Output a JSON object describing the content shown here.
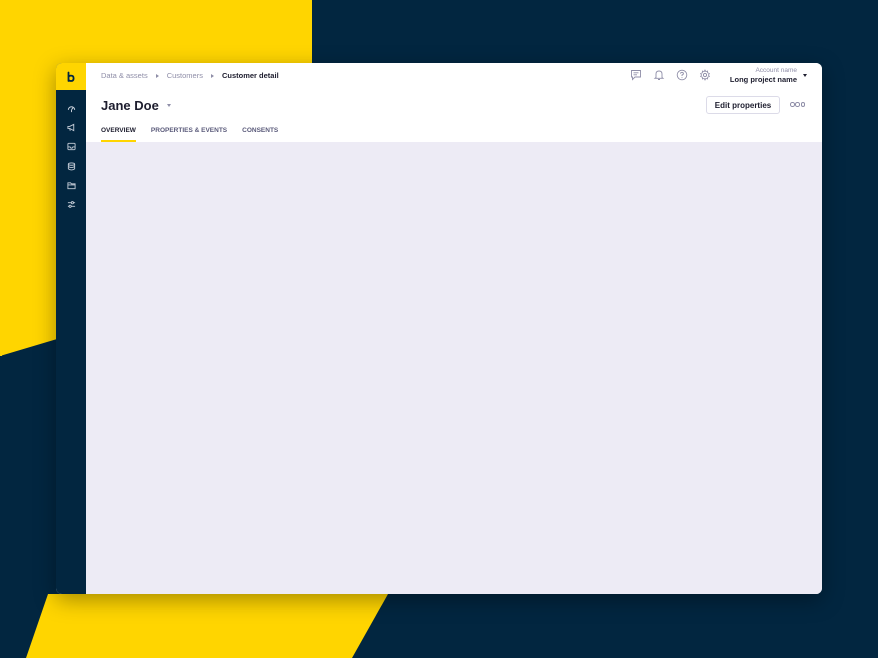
{
  "colors": {
    "brand_yellow": "#FFD500",
    "navy": "#022640",
    "content_bg": "#edebf5",
    "text_primary": "#1d1d2e",
    "text_muted": "#8f8ea8"
  },
  "sidebar": {
    "logo_icon": "bloomreach-logo-icon",
    "items": [
      {
        "icon": "dashboard-gauge-icon"
      },
      {
        "icon": "campaign-megaphone-icon"
      },
      {
        "icon": "inbox-icon"
      },
      {
        "icon": "database-icon"
      },
      {
        "icon": "folder-icon"
      },
      {
        "icon": "settings-sliders-icon"
      }
    ]
  },
  "breadcrumb": {
    "items": [
      "Data & assets",
      "Customers"
    ],
    "current": "Customer detail"
  },
  "topbar": {
    "icons": [
      "chat-icon",
      "bell-icon",
      "help-icon",
      "gear-icon"
    ],
    "account_name": "Account name",
    "project_name": "Long project name"
  },
  "header": {
    "title": "Jane Doe",
    "edit_button": "Edit properties",
    "more_icon": "more-options-icon"
  },
  "tabs": [
    {
      "label": "OVERVIEW",
      "active": true
    },
    {
      "label": "PROPERTIES & EVENTS",
      "active": false
    },
    {
      "label": "CONSENTS",
      "active": false
    }
  ]
}
